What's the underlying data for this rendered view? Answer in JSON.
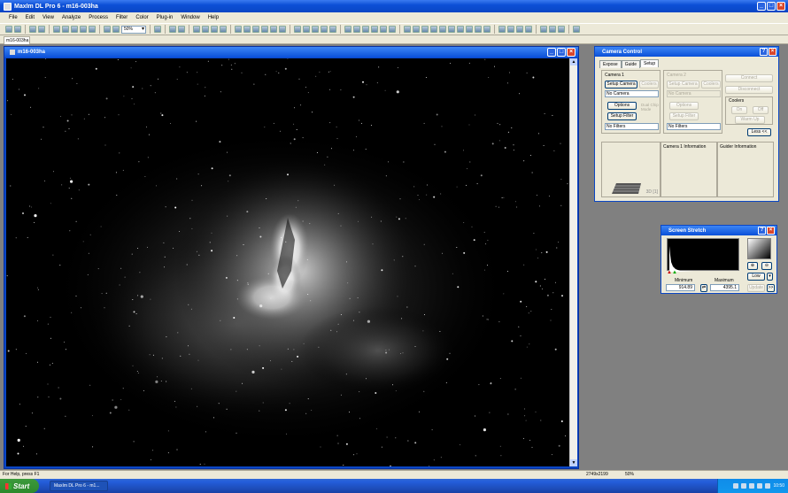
{
  "app": {
    "title": "MaxIm DL Pro 6 - m16-003ha"
  },
  "menu": [
    "File",
    "Edit",
    "View",
    "Analyze",
    "Process",
    "Filter",
    "Color",
    "Plug-in",
    "Window",
    "Help"
  ],
  "toolbar": {
    "zoom": "50%"
  },
  "doc_tab": "m16-003ha",
  "image_window": {
    "title": "m16-003ha"
  },
  "camera_control": {
    "title": "Camera Control",
    "tabs": [
      "Expose",
      "Guide",
      "Setup"
    ],
    "active_tab": "Setup",
    "camera1": {
      "label": "Camera 1",
      "setup": "Setup Camera",
      "coolers": "Coolers",
      "camera": "No Camera",
      "options": "Options",
      "dual_chip": "Dual Chip Mode",
      "setup_filter": "Setup Filter",
      "filters": "No Filters"
    },
    "camera2": {
      "label": "Camera 2",
      "setup": "Setup Camera",
      "coolers": "Coolers",
      "camera": "No Camera",
      "options": "Options",
      "setup_filter": "Setup Filter",
      "filters": "No Filters"
    },
    "connect": "Connect",
    "disconnect": "Disconnect",
    "coolers_label": "Coolers",
    "on": "On",
    "off": "Off",
    "warm_up": "Warm Up",
    "less": "Less <<",
    "cam1_info": "Camera 1 Information",
    "guider_info": "Guider Information",
    "view3d": "3D [1]"
  },
  "screen_stretch": {
    "title": "Screen Stretch",
    "minimum_label": "Minimum",
    "maximum_label": "Maximum",
    "minimum": "914.89",
    "maximum": "4395.1",
    "mode": "Low",
    "update": "Update",
    "expand": ">>"
  },
  "status": {
    "help": "For Help, press F1",
    "dims": "2749x2199",
    "zoom": "50%"
  },
  "taskbar": {
    "start": "Start",
    "item": "MaxIm DL Pro 6 - m1...",
    "clock": "10:50"
  }
}
